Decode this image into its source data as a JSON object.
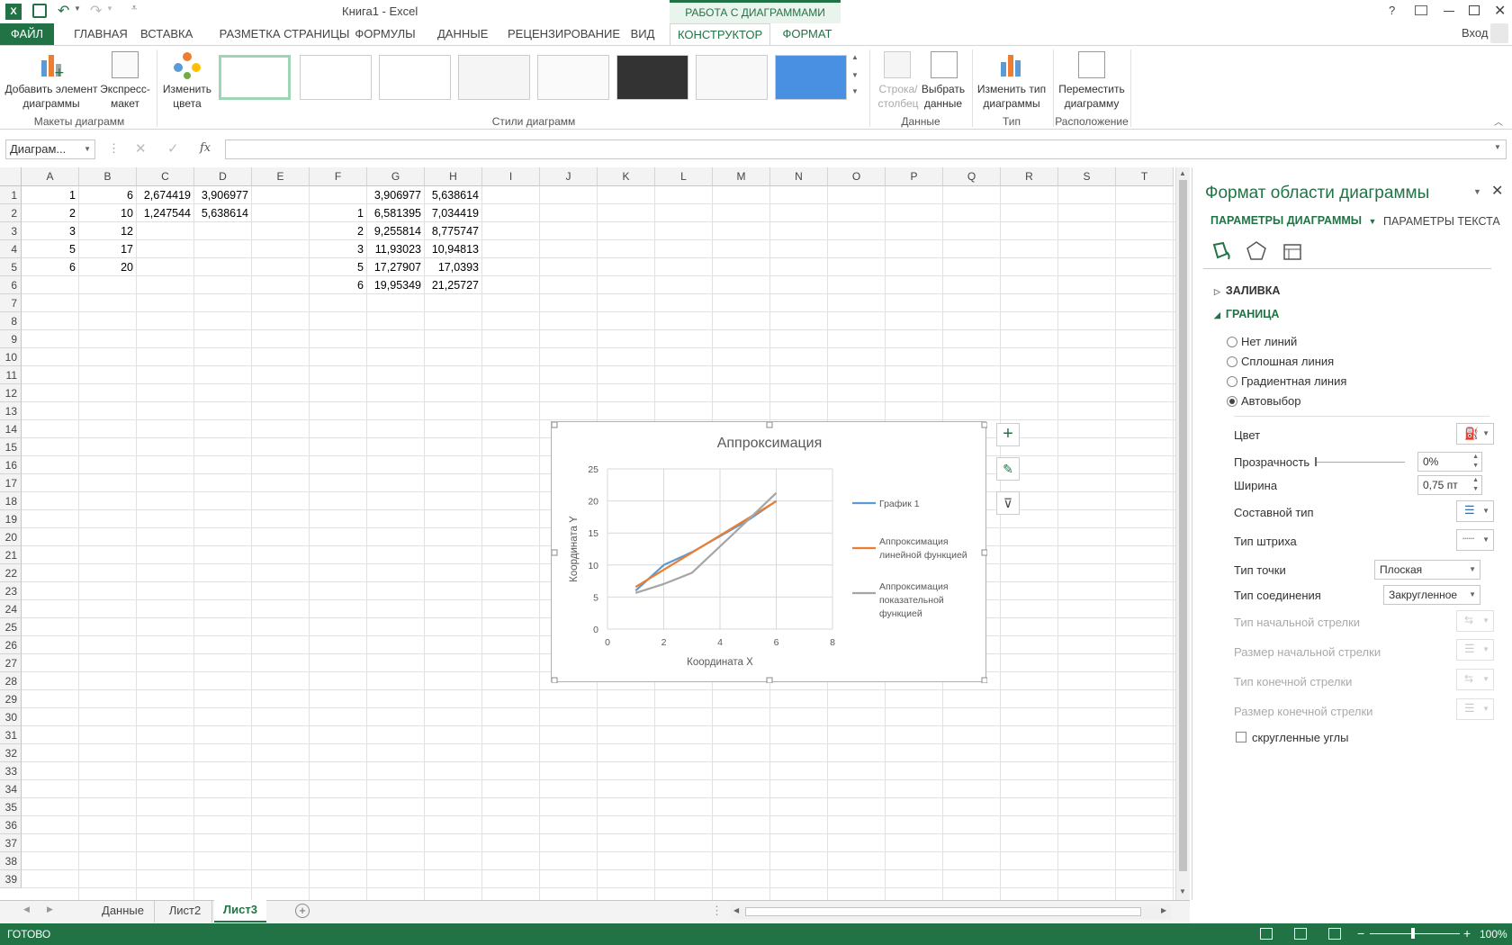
{
  "window": {
    "title": "Книга1 - Excel",
    "help": "?",
    "signin": "Вход",
    "context_tab_group": "РАБОТА С ДИАГРАММАМИ"
  },
  "tabs": [
    "ФАЙЛ",
    "ГЛАВНАЯ",
    "ВСТАВКА",
    "РАЗМЕТКА СТРАНИЦЫ",
    "ФОРМУЛЫ",
    "ДАННЫЕ",
    "РЕЦЕНЗИРОВАНИЕ",
    "ВИД",
    "КОНСТРУКТОР",
    "ФОРМАТ"
  ],
  "ribbon": {
    "add_element_1": "Добавить элемент",
    "add_element_2": "диаграммы",
    "express_1": "Экспресс-",
    "express_2": "макет",
    "change_colors_1": "Изменить",
    "change_colors_2": "цвета",
    "group_layouts": "Макеты диаграмм",
    "group_styles": "Стили диаграмм",
    "row_col_1": "Строка/",
    "row_col_2": "столбец",
    "select_data_1": "Выбрать",
    "select_data_2": "данные",
    "group_data": "Данные",
    "change_type_1": "Изменить тип",
    "change_type_2": "диаграммы",
    "group_type": "Тип",
    "move_1": "Переместить",
    "move_2": "диаграмму",
    "group_location": "Расположение"
  },
  "formula_bar": {
    "name_box": "Диаграм...",
    "fx": "fx",
    "value": ""
  },
  "columns": [
    "A",
    "B",
    "C",
    "D",
    "E",
    "F",
    "G",
    "H",
    "I",
    "J",
    "K",
    "L",
    "M",
    "N",
    "O",
    "P",
    "Q",
    "R",
    "S",
    "T"
  ],
  "rows": [
    "1",
    "2",
    "3",
    "4",
    "5",
    "6",
    "7",
    "8",
    "9",
    "10",
    "11",
    "12",
    "13",
    "14",
    "15",
    "16",
    "17",
    "18",
    "19",
    "20",
    "21",
    "22",
    "23",
    "24",
    "25",
    "26",
    "27",
    "28",
    "29",
    "30",
    "31",
    "32",
    "33",
    "34",
    "35",
    "36",
    "37",
    "38",
    "39"
  ],
  "cells": [
    [
      "1",
      "6",
      "2,674419",
      "3,906977",
      "",
      "",
      "3,906977",
      "5,638614"
    ],
    [
      "2",
      "10",
      "1,247544",
      "5,638614",
      "",
      "1",
      "6,581395",
      "7,034419"
    ],
    [
      "3",
      "12",
      "",
      "",
      "",
      "2",
      "9,255814",
      "8,775747"
    ],
    [
      "5",
      "17",
      "",
      "",
      "",
      "3",
      "11,93023",
      "10,94813"
    ],
    [
      "6",
      "20",
      "",
      "",
      "",
      "5",
      "17,27907",
      "17,0393"
    ],
    [
      "",
      "",
      "",
      "",
      "",
      "6",
      "19,95349",
      "21,25727"
    ]
  ],
  "chart_data": {
    "type": "line",
    "title": "Аппроксимация",
    "xlabel": "Координата X",
    "ylabel": "Координата Y",
    "xlim": [
      0,
      8
    ],
    "ylim": [
      0,
      25
    ],
    "xticks": [
      "0",
      "2",
      "4",
      "6",
      "8"
    ],
    "yticks": [
      "0",
      "5",
      "10",
      "15",
      "20",
      "25"
    ],
    "grid": true,
    "legend_position": "right",
    "series": [
      {
        "name": "График 1",
        "color": "#5b9bd5",
        "x": [
          1,
          2,
          3,
          5,
          6
        ],
        "y": [
          6,
          10,
          12,
          17,
          20
        ]
      },
      {
        "name": "Аппроксимация линейной функцией",
        "color": "#ed7d31",
        "x": [
          1,
          2,
          3,
          5,
          6
        ],
        "y": [
          6.581395,
          9.255814,
          11.93023,
          17.27907,
          19.95349
        ]
      },
      {
        "name": "Аппроксимация показательной функцией",
        "color": "#a5a5a5",
        "x": [
          1,
          2,
          3,
          5,
          6
        ],
        "y": [
          5.638614,
          7.034419,
          8.775747,
          17.0393,
          21.25727
        ]
      }
    ]
  },
  "sheets": [
    "Данные",
    "Лист2",
    "Лист3"
  ],
  "status": {
    "ready": "ГОТОВО",
    "zoom": "100%"
  },
  "pane": {
    "title": "Формат области диаграммы",
    "tab_chart": "ПАРАМЕТРЫ ДИАГРАММЫ",
    "tab_text": "ПАРАМЕТРЫ ТЕКСТА",
    "fill": "ЗАЛИВКА",
    "border": "ГРАНИЦА",
    "opt_none": "Нет линий",
    "opt_solid": "Сплошная линия",
    "opt_gradient": "Градиентная линия",
    "opt_auto": "Автовыбор",
    "color": "Цвет",
    "transparency": "Прозрачность",
    "transparency_val": "0%",
    "width": "Ширина",
    "width_val": "0,75 пт",
    "compound": "Составной тип",
    "dash": "Тип штриха",
    "cap": "Тип точки",
    "cap_val": "Плоская",
    "join": "Тип соединения",
    "join_val": "Закругленное",
    "begin_arrow": "Тип начальной стрелки",
    "begin_size": "Размер начальной стрелки",
    "end_arrow": "Тип конечной стрелки",
    "end_size": "Размер конечной стрелки",
    "rounded": "скругленные углы"
  }
}
